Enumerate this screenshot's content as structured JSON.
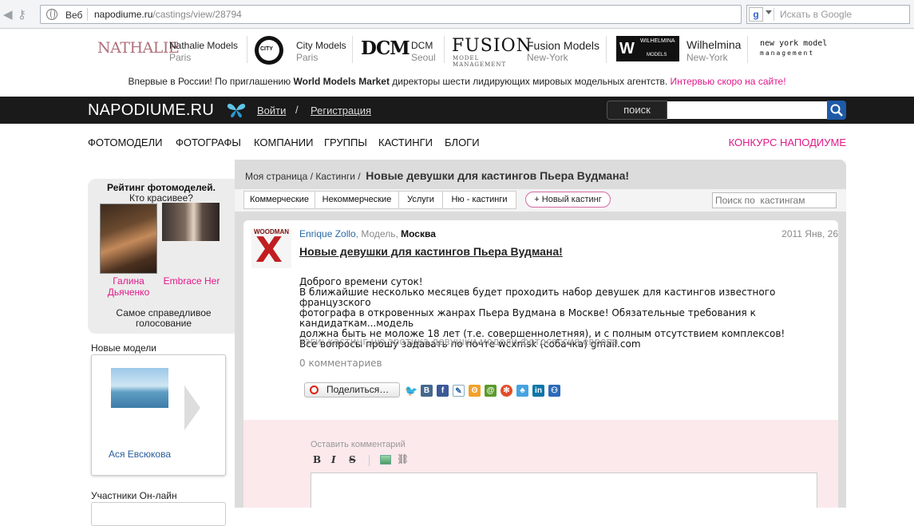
{
  "browser": {
    "web_label": "Веб",
    "url_host": "napodiume.ru",
    "url_path": "/castings/view/28794",
    "google_placeholder": "Искать в Google"
  },
  "partners": [
    {
      "logo": "NATHALIE",
      "name": "Nathalie Models",
      "city": "Paris"
    },
    {
      "logo": "CITY",
      "name": "City Models",
      "city": "Paris"
    },
    {
      "logo": "DCM",
      "name": "DCM",
      "city": "Seoul"
    },
    {
      "logo": "FUSION",
      "logo_sub": "MODEL MANAGEMENT",
      "name": "Fusion Models",
      "city": "New-York"
    },
    {
      "logo": "W",
      "logo_top": "WILHELMINA",
      "logo_bottom": "MODELS",
      "name": "Wilhelmina",
      "city": "New-York"
    },
    {
      "logo": "new york model",
      "logo_sub": "management"
    }
  ],
  "promo": {
    "part1": "Впервые в России! По приглашению ",
    "bold": "World Models Market",
    "part2": " директоры шести лидирующих мировых модельных агентств. ",
    "link": "Интервью скоро на сайте!"
  },
  "header": {
    "logo": "NAPODIUME.RU",
    "login": "Войти",
    "slash": "/",
    "register": "Регистрация",
    "search_label": "поиск"
  },
  "nav": {
    "items": [
      "ФОТОМОДЕЛИ",
      "ФОТОГРАФЫ",
      "КОМПАНИИ",
      "ГРУППЫ",
      "КАСТИНГИ",
      "БЛОГИ"
    ],
    "contest": "КОНКУРС НАПОДИУМЕ"
  },
  "sidebar": {
    "rating_title": "Рейтинг фотомоделей.",
    "rating_sub": "Кто красивее?",
    "photo1_name": "Галина Дьяченко",
    "photo2_name": "Embrace Her",
    "fair_vote": "Самое справедливое голосование",
    "new_models_title": "Новые модели",
    "new_model_name": "Ася Евсюкова",
    "online_title": "Участники Он-лайн"
  },
  "content": {
    "breadcrumb_home": "Моя страница",
    "breadcrumb_castings": "Кастинги",
    "breadcrumb_current": "Новые девушки для кастингов Пьера Вудмана!",
    "tabs": [
      "Коммерческие",
      "Некоммерческие",
      "Услуги",
      "Ню - кастинги"
    ],
    "new_casting": "+ Новый кастинг",
    "search_placeholder": "Поиск по  кастингам"
  },
  "post": {
    "photo_text": "WOODMAN",
    "author": "Enrique Zollo",
    "role": "Модель,",
    "city": "Москва",
    "date": "2011 Янв, 26",
    "title": "Новые девушки для кастингов Пьера Вудмана!",
    "body_lines": [
      "Доброго времени суток!",
      "В ближайшие несколько месяцев будет проходить набор девушек для кастингов известного французского",
      "фотографа в откровенных жанрах Пьера Вудмана в Москве! Обязательные требования к кандидаткам...модель",
      "должна быть не моложе 18 лет (т.е. совершеннолетняя), и с полным отсутствием комплексов!",
      "Все вопросы прошу задавать по почте wcxmsk (собачка) gmail.com"
    ],
    "tags": "тэги: кастинг,ню,эротика,девушки,модели,фотосессия,европа",
    "comments_count": "0 комментариев",
    "share_label": "Поделиться…",
    "comment_label": "Оставить комментарий"
  },
  "colors": {
    "accent_pink": "#e0198a",
    "link_blue": "#2a6aa8",
    "topbar": "#1a1a1a",
    "comment_bg": "#fbe9ec"
  }
}
